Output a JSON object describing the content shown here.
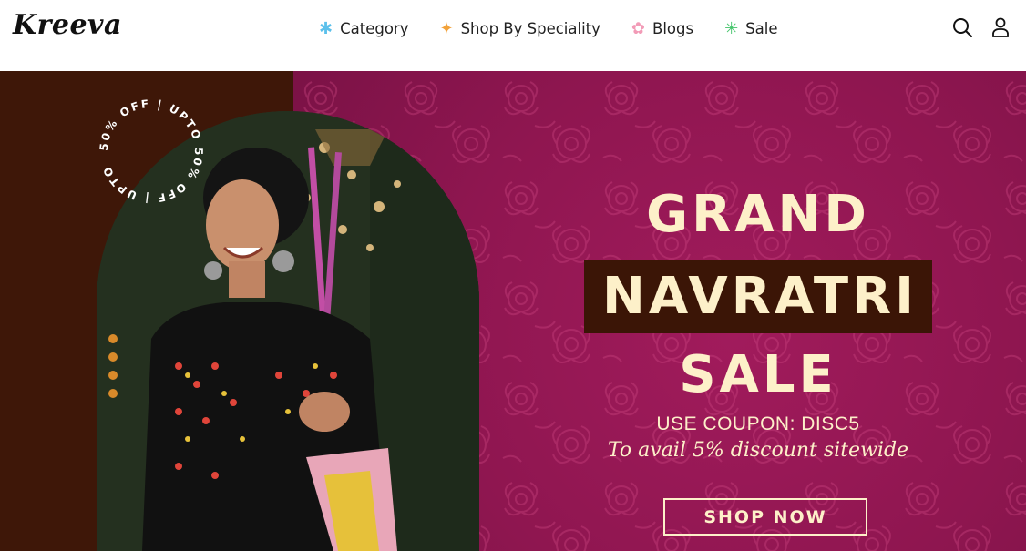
{
  "header": {
    "logo": "Kreeva",
    "nav": [
      {
        "label": "Category",
        "icon": "snowflake-icon",
        "color": "#5bc0eb"
      },
      {
        "label": "Shop By Speciality",
        "icon": "sparkle-icon",
        "color": "#f2a23a"
      },
      {
        "label": "Blogs",
        "icon": "flower-icon",
        "color": "#f29bb7"
      },
      {
        "label": "Sale",
        "icon": "asterisk-icon",
        "color": "#43c46a"
      }
    ],
    "icons": [
      "search-icon",
      "user-icon"
    ]
  },
  "banner": {
    "badge_text": "50% OFF | UPTO 50% OFF | UPTO",
    "line1": "GRAND",
    "line2": "NAVRATRI",
    "line3": "SALE",
    "coupon": "USE COUPON: DISC5",
    "avail": "To avail 5% discount sitewide",
    "cta": "SHOP NOW",
    "colors": {
      "cream": "#fdf0c9",
      "magenta": "#8f1650",
      "brown": "#3e1708"
    }
  }
}
